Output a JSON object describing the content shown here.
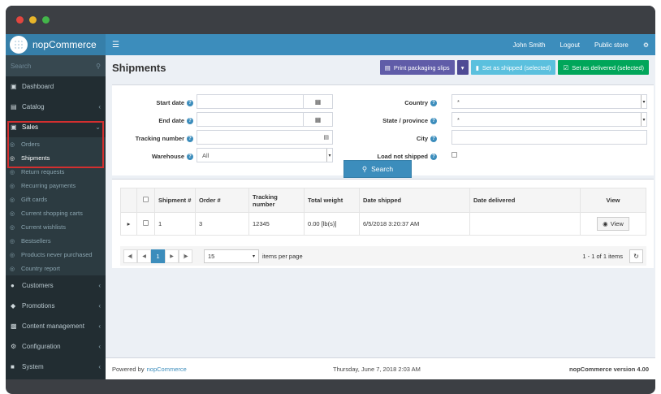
{
  "brand": "nopCommerce",
  "sidebar": {
    "search_placeholder": "Search",
    "items": [
      {
        "label": "Dashboard"
      },
      {
        "label": "Catalog"
      },
      {
        "label": "Sales"
      },
      {
        "label": "Customers"
      },
      {
        "label": "Promotions"
      },
      {
        "label": "Content management"
      },
      {
        "label": "Configuration"
      },
      {
        "label": "System"
      }
    ],
    "sales_sub": [
      "Orders",
      "Shipments",
      "Return requests",
      "Recurring payments",
      "Gift cards",
      "Current shopping carts",
      "Current wishlists",
      "Bestsellers",
      "Products never purchased",
      "Country report"
    ]
  },
  "topbar": {
    "user": "John Smith",
    "logout": "Logout",
    "public_store": "Public store"
  },
  "header": {
    "title": "Shipments",
    "print_btn": "Print packaging slips",
    "shipped_btn": "Set as shipped (selected)",
    "delivered_btn": "Set as delivered (selected)"
  },
  "filters": {
    "start_date": "Start date",
    "end_date": "End date",
    "tracking_number": "Tracking number",
    "warehouse": "Warehouse",
    "warehouse_value": "All",
    "country": "Country",
    "country_value": "*",
    "state": "State / province",
    "state_value": "*",
    "city": "City",
    "load_not_shipped": "Load not shipped",
    "search_btn": "Search"
  },
  "grid": {
    "columns": [
      "Shipment #",
      "Order #",
      "Tracking number",
      "Total weight",
      "Date shipped",
      "Date delivered",
      "View"
    ],
    "rows": [
      {
        "shipment": "1",
        "order": "3",
        "tracking": "12345",
        "weight": "0.00 [lb(s)]",
        "shipped": "6/5/2018 3:20:37 AM",
        "delivered": "",
        "view": "View"
      }
    ],
    "page": "1",
    "page_size": "15",
    "items_per_page": "items per page",
    "summary": "1 - 1 of 1 items"
  },
  "footer": {
    "powered": "Powered by",
    "powered_link": "nopCommerce",
    "date": "Thursday, June 7, 2018 2:03 AM",
    "version": "nopCommerce version 4.00"
  }
}
